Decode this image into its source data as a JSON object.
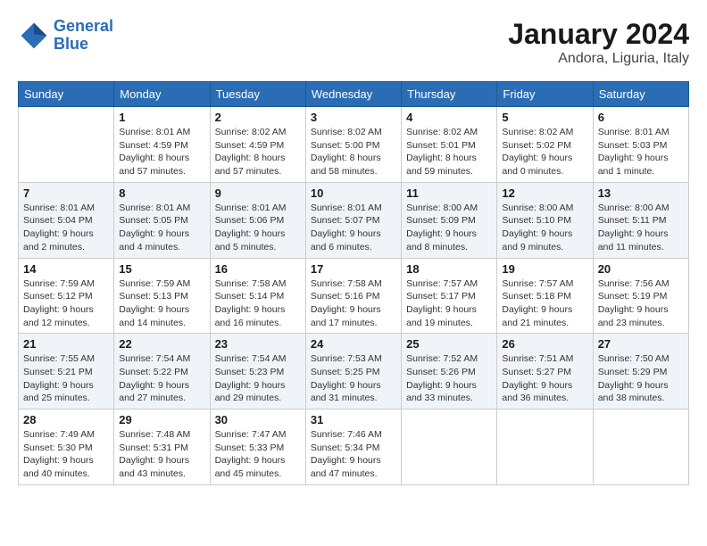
{
  "header": {
    "logo_line1": "General",
    "logo_line2": "Blue",
    "month": "January 2024",
    "location": "Andora, Liguria, Italy"
  },
  "weekdays": [
    "Sunday",
    "Monday",
    "Tuesday",
    "Wednesday",
    "Thursday",
    "Friday",
    "Saturday"
  ],
  "weeks": [
    [
      {
        "day": "",
        "sunrise": "",
        "sunset": "",
        "daylight": ""
      },
      {
        "day": "1",
        "sunrise": "Sunrise: 8:01 AM",
        "sunset": "Sunset: 4:59 PM",
        "daylight": "Daylight: 8 hours and 57 minutes."
      },
      {
        "day": "2",
        "sunrise": "Sunrise: 8:02 AM",
        "sunset": "Sunset: 4:59 PM",
        "daylight": "Daylight: 8 hours and 57 minutes."
      },
      {
        "day": "3",
        "sunrise": "Sunrise: 8:02 AM",
        "sunset": "Sunset: 5:00 PM",
        "daylight": "Daylight: 8 hours and 58 minutes."
      },
      {
        "day": "4",
        "sunrise": "Sunrise: 8:02 AM",
        "sunset": "Sunset: 5:01 PM",
        "daylight": "Daylight: 8 hours and 59 minutes."
      },
      {
        "day": "5",
        "sunrise": "Sunrise: 8:02 AM",
        "sunset": "Sunset: 5:02 PM",
        "daylight": "Daylight: 9 hours and 0 minutes."
      },
      {
        "day": "6",
        "sunrise": "Sunrise: 8:01 AM",
        "sunset": "Sunset: 5:03 PM",
        "daylight": "Daylight: 9 hours and 1 minute."
      }
    ],
    [
      {
        "day": "7",
        "sunrise": "Sunrise: 8:01 AM",
        "sunset": "Sunset: 5:04 PM",
        "daylight": "Daylight: 9 hours and 2 minutes."
      },
      {
        "day": "8",
        "sunrise": "Sunrise: 8:01 AM",
        "sunset": "Sunset: 5:05 PM",
        "daylight": "Daylight: 9 hours and 4 minutes."
      },
      {
        "day": "9",
        "sunrise": "Sunrise: 8:01 AM",
        "sunset": "Sunset: 5:06 PM",
        "daylight": "Daylight: 9 hours and 5 minutes."
      },
      {
        "day": "10",
        "sunrise": "Sunrise: 8:01 AM",
        "sunset": "Sunset: 5:07 PM",
        "daylight": "Daylight: 9 hours and 6 minutes."
      },
      {
        "day": "11",
        "sunrise": "Sunrise: 8:00 AM",
        "sunset": "Sunset: 5:09 PM",
        "daylight": "Daylight: 9 hours and 8 minutes."
      },
      {
        "day": "12",
        "sunrise": "Sunrise: 8:00 AM",
        "sunset": "Sunset: 5:10 PM",
        "daylight": "Daylight: 9 hours and 9 minutes."
      },
      {
        "day": "13",
        "sunrise": "Sunrise: 8:00 AM",
        "sunset": "Sunset: 5:11 PM",
        "daylight": "Daylight: 9 hours and 11 minutes."
      }
    ],
    [
      {
        "day": "14",
        "sunrise": "Sunrise: 7:59 AM",
        "sunset": "Sunset: 5:12 PM",
        "daylight": "Daylight: 9 hours and 12 minutes."
      },
      {
        "day": "15",
        "sunrise": "Sunrise: 7:59 AM",
        "sunset": "Sunset: 5:13 PM",
        "daylight": "Daylight: 9 hours and 14 minutes."
      },
      {
        "day": "16",
        "sunrise": "Sunrise: 7:58 AM",
        "sunset": "Sunset: 5:14 PM",
        "daylight": "Daylight: 9 hours and 16 minutes."
      },
      {
        "day": "17",
        "sunrise": "Sunrise: 7:58 AM",
        "sunset": "Sunset: 5:16 PM",
        "daylight": "Daylight: 9 hours and 17 minutes."
      },
      {
        "day": "18",
        "sunrise": "Sunrise: 7:57 AM",
        "sunset": "Sunset: 5:17 PM",
        "daylight": "Daylight: 9 hours and 19 minutes."
      },
      {
        "day": "19",
        "sunrise": "Sunrise: 7:57 AM",
        "sunset": "Sunset: 5:18 PM",
        "daylight": "Daylight: 9 hours and 21 minutes."
      },
      {
        "day": "20",
        "sunrise": "Sunrise: 7:56 AM",
        "sunset": "Sunset: 5:19 PM",
        "daylight": "Daylight: 9 hours and 23 minutes."
      }
    ],
    [
      {
        "day": "21",
        "sunrise": "Sunrise: 7:55 AM",
        "sunset": "Sunset: 5:21 PM",
        "daylight": "Daylight: 9 hours and 25 minutes."
      },
      {
        "day": "22",
        "sunrise": "Sunrise: 7:54 AM",
        "sunset": "Sunset: 5:22 PM",
        "daylight": "Daylight: 9 hours and 27 minutes."
      },
      {
        "day": "23",
        "sunrise": "Sunrise: 7:54 AM",
        "sunset": "Sunset: 5:23 PM",
        "daylight": "Daylight: 9 hours and 29 minutes."
      },
      {
        "day": "24",
        "sunrise": "Sunrise: 7:53 AM",
        "sunset": "Sunset: 5:25 PM",
        "daylight": "Daylight: 9 hours and 31 minutes."
      },
      {
        "day": "25",
        "sunrise": "Sunrise: 7:52 AM",
        "sunset": "Sunset: 5:26 PM",
        "daylight": "Daylight: 9 hours and 33 minutes."
      },
      {
        "day": "26",
        "sunrise": "Sunrise: 7:51 AM",
        "sunset": "Sunset: 5:27 PM",
        "daylight": "Daylight: 9 hours and 36 minutes."
      },
      {
        "day": "27",
        "sunrise": "Sunrise: 7:50 AM",
        "sunset": "Sunset: 5:29 PM",
        "daylight": "Daylight: 9 hours and 38 minutes."
      }
    ],
    [
      {
        "day": "28",
        "sunrise": "Sunrise: 7:49 AM",
        "sunset": "Sunset: 5:30 PM",
        "daylight": "Daylight: 9 hours and 40 minutes."
      },
      {
        "day": "29",
        "sunrise": "Sunrise: 7:48 AM",
        "sunset": "Sunset: 5:31 PM",
        "daylight": "Daylight: 9 hours and 43 minutes."
      },
      {
        "day": "30",
        "sunrise": "Sunrise: 7:47 AM",
        "sunset": "Sunset: 5:33 PM",
        "daylight": "Daylight: 9 hours and 45 minutes."
      },
      {
        "day": "31",
        "sunrise": "Sunrise: 7:46 AM",
        "sunset": "Sunset: 5:34 PM",
        "daylight": "Daylight: 9 hours and 47 minutes."
      },
      {
        "day": "",
        "sunrise": "",
        "sunset": "",
        "daylight": ""
      },
      {
        "day": "",
        "sunrise": "",
        "sunset": "",
        "daylight": ""
      },
      {
        "day": "",
        "sunrise": "",
        "sunset": "",
        "daylight": ""
      }
    ]
  ]
}
